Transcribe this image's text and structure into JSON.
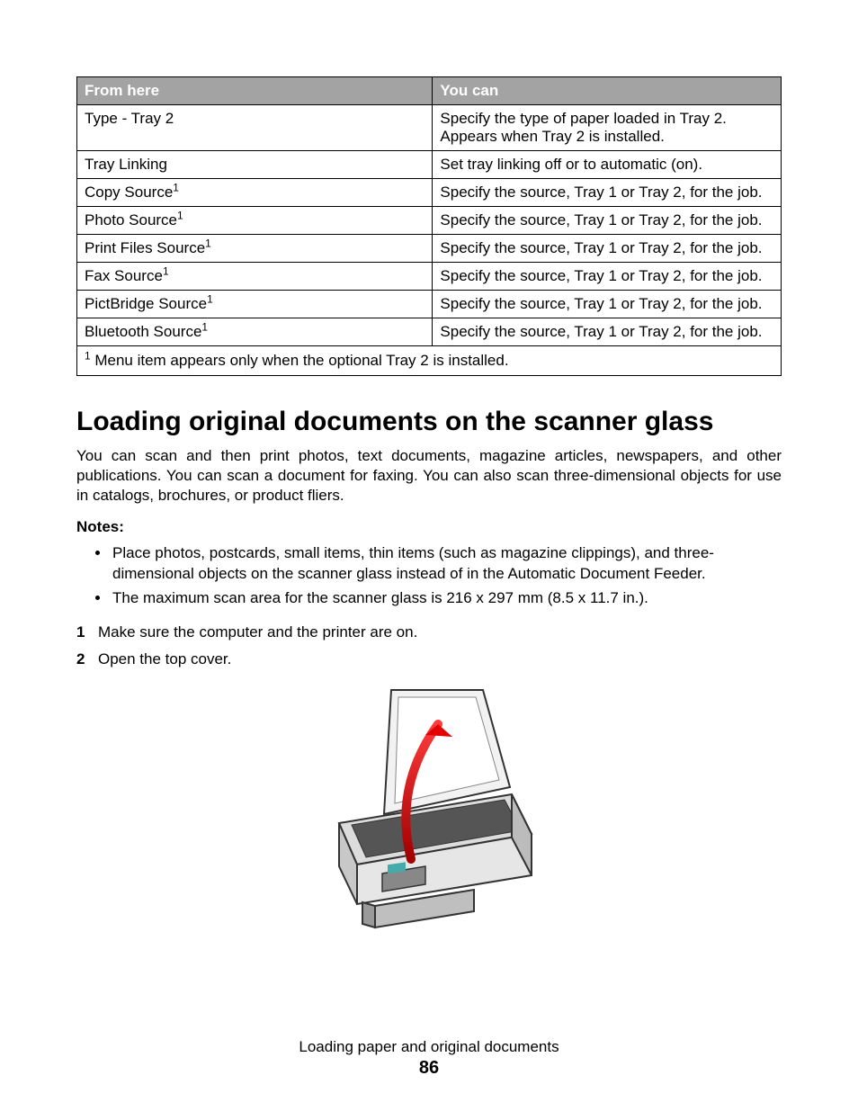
{
  "table": {
    "headers": [
      "From here",
      "You can"
    ],
    "rows": [
      {
        "c0": "Type - Tray 2",
        "sup": "",
        "c1_line1": "Specify the type of paper loaded in Tray 2.",
        "c1_line2": "Appears when Tray 2 is installed."
      },
      {
        "c0": "Tray Linking",
        "sup": "",
        "c1_line1": "Set tray linking off or to automatic (on).",
        "c1_line2": ""
      },
      {
        "c0": "Copy Source",
        "sup": "1",
        "c1_line1": "Specify the source, Tray 1 or Tray 2, for the job.",
        "c1_line2": ""
      },
      {
        "c0": "Photo Source",
        "sup": "1",
        "c1_line1": "Specify the source, Tray 1 or Tray 2, for the job.",
        "c1_line2": ""
      },
      {
        "c0": "Print Files Source",
        "sup": "1",
        "c1_line1": "Specify the source, Tray 1 or Tray 2, for the job.",
        "c1_line2": ""
      },
      {
        "c0": "Fax Source",
        "sup": "1",
        "c1_line1": "Specify the source, Tray 1 or Tray 2, for the job.",
        "c1_line2": ""
      },
      {
        "c0": "PictBridge Source",
        "sup": "1",
        "c1_line1": "Specify the source, Tray 1 or Tray 2, for the job.",
        "c1_line2": ""
      },
      {
        "c0": "Bluetooth Source",
        "sup": "1",
        "c1_line1": "Specify the source, Tray 1 or Tray 2, for the job.",
        "c1_line2": ""
      }
    ],
    "footnote_sup": "1",
    "footnote_text": " Menu item appears only when the optional Tray 2 is installed."
  },
  "section_title": "Loading original documents on the scanner glass",
  "intro_paragraph": "You can scan and then print photos, text documents, magazine articles, newspapers, and other publications. You can scan a document for faxing. You can also scan three-dimensional objects for use in catalogs, brochures, or product fliers.",
  "notes_label": "Notes:",
  "notes": [
    "Place photos, postcards, small items, thin items (such as magazine clippings), and three-dimensional objects on the scanner glass instead of in the Automatic Document Feeder.",
    "The maximum scan area for the scanner glass is 216 x 297 mm (8.5 x 11.7 in.)."
  ],
  "steps": [
    "Make sure the computer and the printer are on.",
    "Open the top cover."
  ],
  "figure_alt": "printer-open-cover-illustration",
  "footer": {
    "chapter": "Loading paper and original documents",
    "page": "86"
  }
}
